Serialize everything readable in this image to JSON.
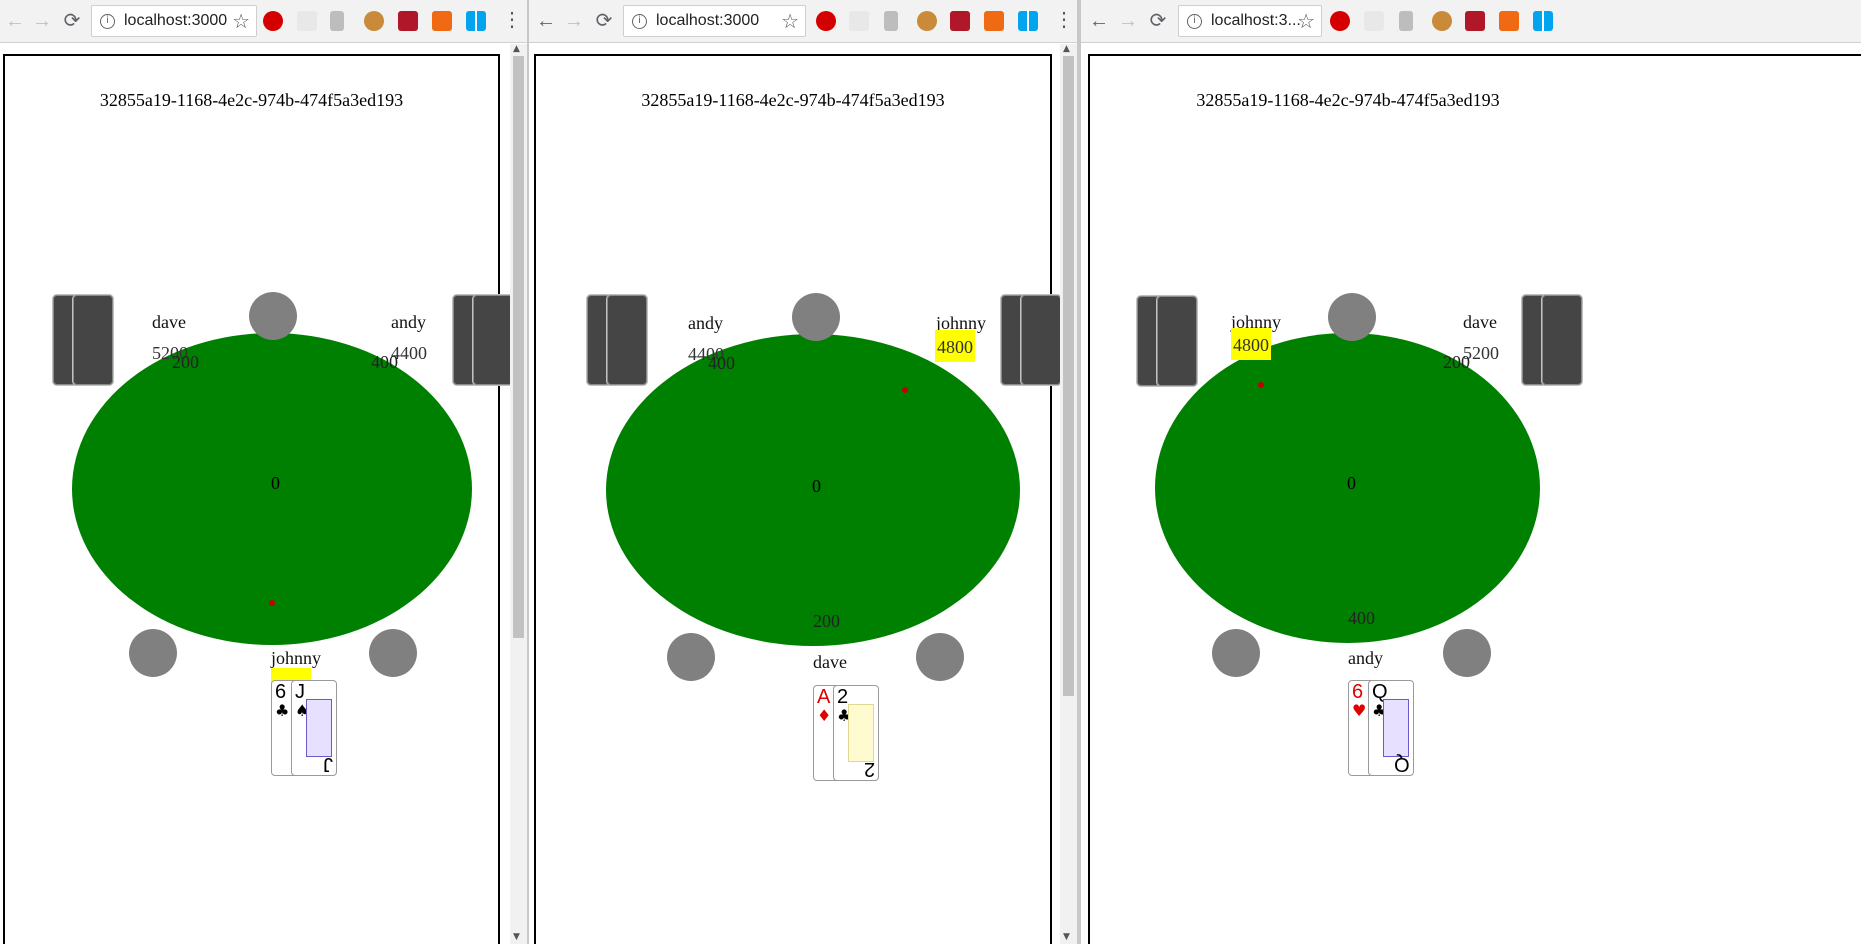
{
  "browser": {
    "url_full": "localhost:3000",
    "url_truncated": "localhost:3..."
  },
  "game": {
    "id": "32855a19-1168-4e2c-974b-474f5a3ed193"
  },
  "windows": [
    {
      "players": {
        "top_left": {
          "name": "dave",
          "chips": "5200",
          "bet": "200"
        },
        "top_right": {
          "name": "andy",
          "chips": "4400",
          "bet": "400"
        },
        "bottom": {
          "name": "johnny",
          "chips": ""
        }
      },
      "pot": "0",
      "hand": [
        {
          "rank": "6",
          "suit": "♣",
          "color": "#000000"
        },
        {
          "rank": "J",
          "suit": "♠",
          "color": "#000000"
        }
      ]
    },
    {
      "players": {
        "top_left": {
          "name": "andy",
          "chips": "4400",
          "bet": "400"
        },
        "top_right": {
          "name": "johnny",
          "chips": "4800"
        },
        "bottom": {
          "name": "dave",
          "bet": "200"
        }
      },
      "pot": "0",
      "hand": [
        {
          "rank": "A",
          "suit": "♦",
          "color": "#e10000"
        },
        {
          "rank": "2",
          "suit": "♣",
          "color": "#000000"
        }
      ]
    },
    {
      "players": {
        "top_left": {
          "name": "johnny",
          "chips": "4800"
        },
        "top_right": {
          "name": "dave",
          "chips": "5200",
          "bet": "200"
        },
        "bottom": {
          "name": "andy",
          "bet": "400"
        }
      },
      "pot": "0",
      "hand": [
        {
          "rank": "6",
          "suit": "♥",
          "color": "#e10000"
        },
        {
          "rank": "Q",
          "suit": "♣",
          "color": "#000000"
        }
      ]
    }
  ],
  "colors": {
    "table_felt": "#008000",
    "highlight": "#ffff00",
    "seat": "#808080",
    "card_back": "#454545"
  },
  "icons": [
    "back-arrow-icon",
    "forward-arrow-icon",
    "reload-icon",
    "info-icon",
    "star-icon",
    "adblock-icon",
    "mail-icon",
    "pencil-icon",
    "cookie-icon",
    "extension-icon",
    "orange-extension-icon",
    "windows-icon",
    "menu-dots-icon"
  ]
}
